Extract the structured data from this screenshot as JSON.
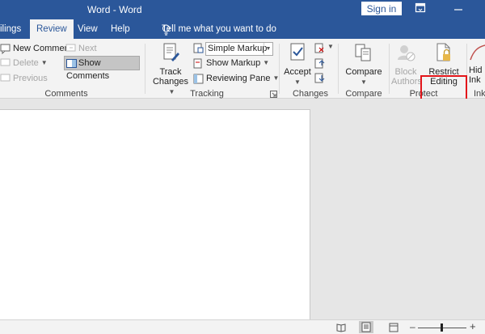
{
  "titlebar": {
    "title": "Word - Word",
    "signin_label": "Sign in"
  },
  "tabs": {
    "mailings": "ilings",
    "review": "Review",
    "view": "View",
    "help": "Help",
    "tell_me": "Tell me what you want to do"
  },
  "ribbon": {
    "comments": {
      "new_comment": "New Comment",
      "delete": "Delete",
      "previous": "Previous",
      "next": "Next",
      "show_comments": "Show Comments",
      "group_label": "Comments"
    },
    "tracking": {
      "track_changes_line1": "Track",
      "track_changes_line2": "Changes",
      "markup_value": "Simple Markup",
      "show_markup": "Show Markup",
      "reviewing_pane": "Reviewing Pane",
      "group_label": "Tracking"
    },
    "changes": {
      "accept": "Accept",
      "group_label": "Changes"
    },
    "compare": {
      "compare": "Compare",
      "group_label": "Compare"
    },
    "protect": {
      "block_line1": "Block",
      "block_line2": "Authors",
      "restrict_line1": "Restrict",
      "restrict_line2": "Editing",
      "group_label": "Protect"
    },
    "ink": {
      "hide_line1": "Hid",
      "hide_line2": "Ink",
      "group_label": "Ink"
    }
  },
  "colors": {
    "accent": "#2b579a",
    "highlight": "#e3151a"
  }
}
